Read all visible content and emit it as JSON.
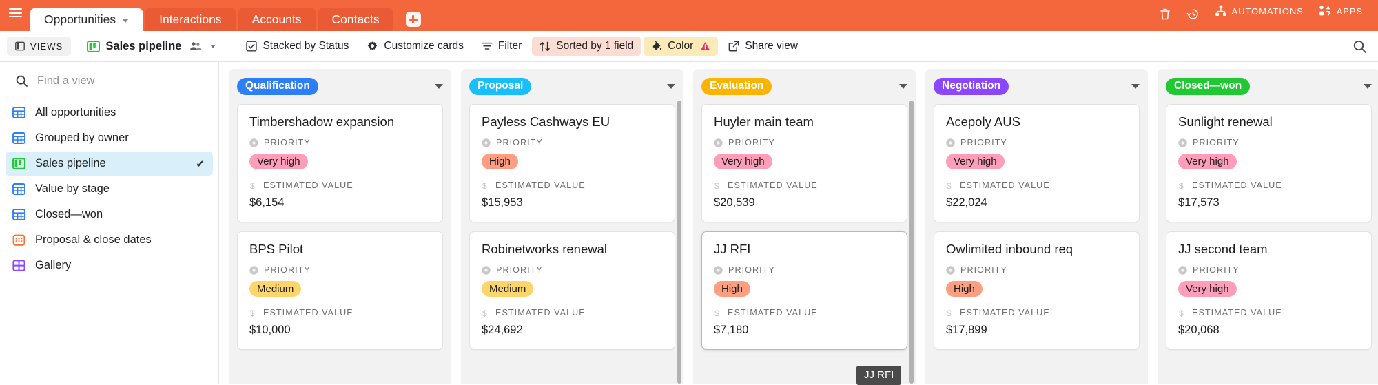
{
  "topbar": {
    "menu_icon": "hamburger-icon",
    "tabs": [
      {
        "label": "Opportunities",
        "active": true,
        "has_caret": true
      },
      {
        "label": "Interactions",
        "active": false,
        "has_caret": false
      },
      {
        "label": "Accounts",
        "active": false,
        "has_caret": false
      },
      {
        "label": "Contacts",
        "active": false,
        "has_caret": false
      }
    ],
    "add_tab_label": "+",
    "trash_icon": "trash-icon",
    "history_icon": "history-clock-icon",
    "automations_label": "AUTOMATIONS",
    "automations_icon": "automations-icon",
    "apps_label": "APPS",
    "apps_icon": "apps-icon",
    "accent_color": "#F4663B"
  },
  "toolbar": {
    "views_label": "VIEWS",
    "views_icon": "sidebar-panel-icon",
    "view_name": "Sales pipeline",
    "view_icon": "kanban-icon",
    "collaborators_icon": "people-icon",
    "stacked_label": "Stacked by Status",
    "stacked_icon": "checkbox-icon",
    "customize_label": "Customize cards",
    "customize_icon": "gear-icon",
    "filter_label": "Filter",
    "filter_icon": "filter-icon",
    "sorted_label": "Sorted by 1 field",
    "sorted_icon": "sort-arrows-icon",
    "color_label": "Color",
    "color_icon": "paint-bucket-icon",
    "color_warning_icon": "warning-triangle-icon",
    "share_label": "Share view",
    "share_icon": "share-external-icon",
    "search_icon": "search-icon",
    "sorted_bg": "#fbddd3",
    "color_bg": "#fcebb8"
  },
  "sidebar": {
    "search": {
      "placeholder": "Find a view",
      "value": "",
      "icon": "search-icon"
    },
    "items": [
      {
        "label": "All opportunities",
        "icon": "grid-table-icon",
        "icon_color": "#2d7ff9",
        "active": false,
        "checked": false
      },
      {
        "label": "Grouped by owner",
        "icon": "grid-table-icon",
        "icon_color": "#2d7ff9",
        "active": false,
        "checked": false
      },
      {
        "label": "Sales pipeline",
        "icon": "kanban-icon",
        "icon_color": "#20c933",
        "active": true,
        "checked": true
      },
      {
        "label": "Value by stage",
        "icon": "grid-table-icon",
        "icon_color": "#2d7ff9",
        "active": false,
        "checked": false
      },
      {
        "label": "Closed—won",
        "icon": "grid-table-icon",
        "icon_color": "#2d7ff9",
        "active": false,
        "checked": false
      },
      {
        "label": "Proposal & close dates",
        "icon": "calendar-icon",
        "icon_color": "#ff6f2c",
        "active": false,
        "checked": false
      },
      {
        "label": "Gallery",
        "icon": "gallery-icon",
        "icon_color": "#8b46ff",
        "active": false,
        "checked": false
      }
    ],
    "check_glyph": "✔"
  },
  "board": {
    "priority_label": "PRIORITY",
    "priority_icon": "single-select-icon",
    "value_label": "ESTIMATED VALUE",
    "value_icon": "currency-icon",
    "columns": [
      {
        "name": "Qualification",
        "pill_color": "#2d7ff9",
        "scrollbar": false,
        "cards": [
          {
            "title": "Timbershadow expansion",
            "priority": "Very high",
            "priority_color": "#ff9eb8",
            "value": "$6,154",
            "focused": false
          },
          {
            "title": "BPS Pilot",
            "priority": "Medium",
            "priority_color": "#fcd66b",
            "value": "$10,000",
            "focused": false
          }
        ]
      },
      {
        "name": "Proposal",
        "pill_color": "#18bfff",
        "scrollbar": true,
        "cards": [
          {
            "title": "Payless Cashways EU",
            "priority": "High",
            "priority_color": "#ff9e80",
            "value": "$15,953",
            "focused": false
          },
          {
            "title": "Robinetworks renewal",
            "priority": "Medium",
            "priority_color": "#fcd66b",
            "value": "$24,692",
            "focused": false
          }
        ]
      },
      {
        "name": "Evaluation",
        "pill_color": "#fcb400",
        "scrollbar": true,
        "cards": [
          {
            "title": "Huyler main team",
            "priority": "Very high",
            "priority_color": "#ff9eb8",
            "value": "$20,539",
            "focused": false
          },
          {
            "title": "JJ RFI",
            "priority": "High",
            "priority_color": "#ff9e80",
            "value": "$7,180",
            "focused": true
          }
        ]
      },
      {
        "name": "Negotiation",
        "pill_color": "#8b46ff",
        "scrollbar": false,
        "cards": [
          {
            "title": "Acepoly AUS",
            "priority": "Very high",
            "priority_color": "#ff9eb8",
            "value": "$22,024",
            "focused": false
          },
          {
            "title": "Owlimited inbound req",
            "priority": "High",
            "priority_color": "#ff9e80",
            "value": "$17,899",
            "focused": false
          }
        ]
      },
      {
        "name": "Closed—won",
        "pill_color": "#20c933",
        "scrollbar": false,
        "cards": [
          {
            "title": "Sunlight renewal",
            "priority": "Very high",
            "priority_color": "#ff9eb8",
            "value": "$17,573",
            "focused": false
          },
          {
            "title": "JJ second team",
            "priority": "Very high",
            "priority_color": "#ff9eb8",
            "value": "$20,068",
            "focused": false
          }
        ]
      }
    ]
  },
  "tooltip": {
    "text": "JJ RFI"
  }
}
